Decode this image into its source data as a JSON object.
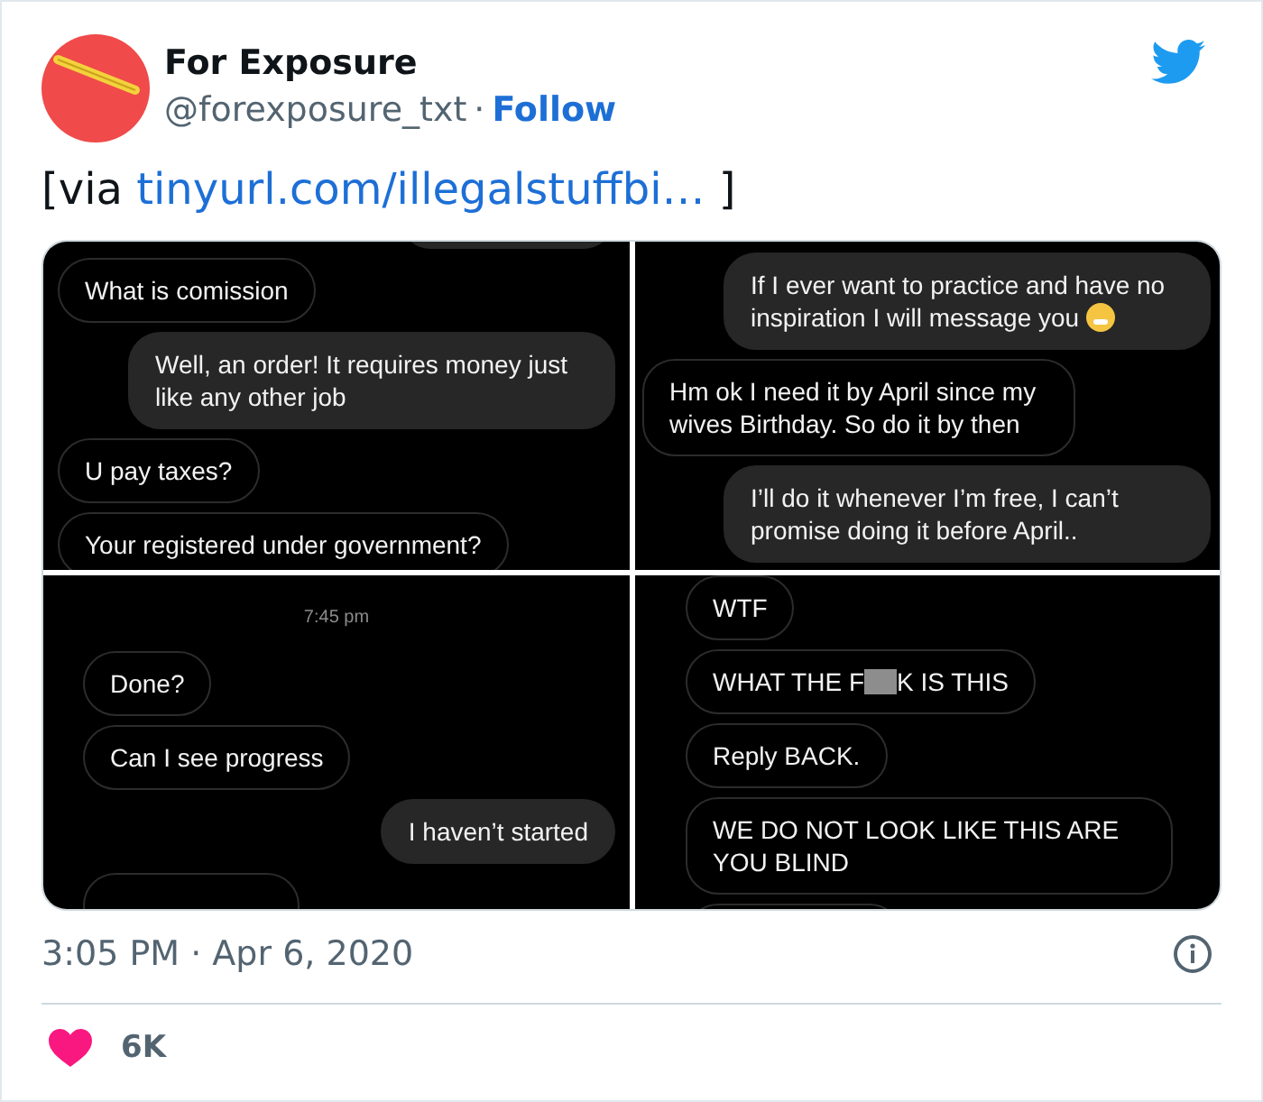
{
  "tweet": {
    "author": {
      "name": "For Exposure",
      "handle": "@forexposure_txt",
      "separator": "·",
      "follow": "Follow"
    },
    "text": {
      "prefix": "[via ",
      "link": "tinyurl.com/illegalstuffbi…",
      "suffix": " ]"
    },
    "image_panels": [
      {
        "messages": [
          {
            "kind": "outgoing",
            "cut": true
          },
          {
            "kind": "incoming",
            "text": "What is comission"
          },
          {
            "kind": "outgoing",
            "text": "Well, an order! It requires money just like any other job"
          },
          {
            "kind": "incoming",
            "text": "U pay taxes?"
          },
          {
            "kind": "incoming",
            "text": "Your registered under government?"
          }
        ]
      },
      {
        "messages": [
          {
            "kind": "outgoing",
            "text": "If I ever want to practice and have no inspiration I will message you",
            "emoji": true
          },
          {
            "kind": "incoming",
            "text": "Hm ok I need it by April since my wives Birthday. So do it by then"
          },
          {
            "kind": "outgoing",
            "text": "I’ll do it whenever I’m free, I can’t promise doing it before April.."
          }
        ]
      },
      {
        "messages": [
          {
            "kind": "time",
            "text": "7:45 pm"
          },
          {
            "kind": "incoming",
            "text": "Done?"
          },
          {
            "kind": "incoming",
            "text": "Can I see progress"
          },
          {
            "kind": "outgoing",
            "text": "I haven’t started"
          },
          {
            "kind": "incoming",
            "cut": true
          }
        ]
      },
      {
        "messages": [
          {
            "kind": "incoming",
            "text": "WTF"
          },
          {
            "kind": "incoming",
            "text": "WHAT THE F",
            "censored": true,
            "text_after": "K IS THIS"
          },
          {
            "kind": "incoming",
            "text": "Reply BACK."
          },
          {
            "kind": "incoming",
            "text": "WE DO NOT LOOK LIKE THIS ARE YOU BLIND"
          },
          {
            "kind": "incoming",
            "cut": true
          }
        ]
      }
    ],
    "timestamp": "3:05 PM · Apr 6, 2020",
    "likes": {
      "count": "6K"
    }
  }
}
